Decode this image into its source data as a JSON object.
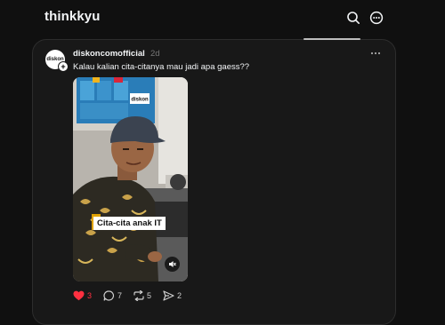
{
  "header": {
    "brand": "thinkkyu",
    "icons": [
      "search-icon",
      "more-icon"
    ]
  },
  "post": {
    "avatar_text": "diskon",
    "username": "diskoncomofficial",
    "time_ago": "2d",
    "caption": "Kalau kalian cita-citanya mau jadi apa gaess??",
    "media": {
      "overlay_text": "Cita-cita anak IT",
      "screen_logo": "diskon"
    },
    "actions": {
      "likes": "3",
      "comments": "7",
      "reposts": "5",
      "shares": "2"
    }
  },
  "colors": {
    "background": "#101010",
    "card": "#181818",
    "like": "#ff3040",
    "muted_text": "#777777"
  }
}
